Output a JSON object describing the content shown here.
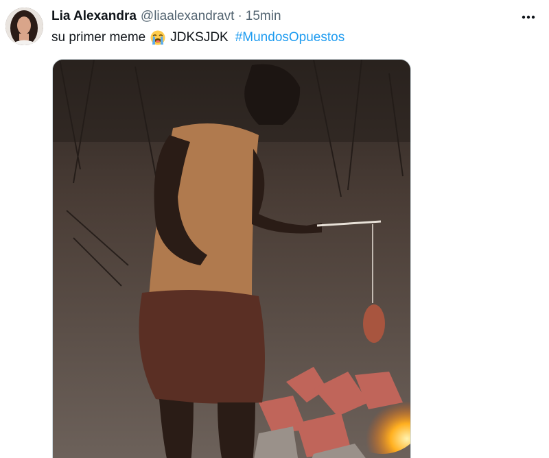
{
  "author": {
    "display_name": "Lia Alexandra",
    "handle": "@liaalexandravt",
    "separator": "·",
    "time": "15min",
    "avatar_icon": "user-avatar"
  },
  "tweet": {
    "text_before_emoji": "su primer meme",
    "emoji": "loudly-crying-face",
    "text_after_emoji": "JDKSJDK",
    "hashtag": "#MundosOpuestos"
  },
  "actions": {
    "more_icon": "more-horizontal-icon"
  },
  "colors": {
    "text": "#0f1419",
    "secondary": "#536471",
    "link": "#1d9bf0",
    "border": "#cfd9de"
  }
}
